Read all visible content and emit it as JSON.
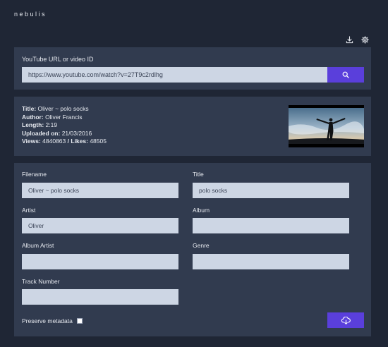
{
  "app": {
    "title": "nebulis"
  },
  "toolbar": {
    "download_icon": "download-icon",
    "settings_icon": "gear-icon"
  },
  "url_section": {
    "label": "YouTube URL or video ID",
    "value": "https://www.youtube.com/watch?v=27T9c2rdlhg",
    "search_icon": "search-icon"
  },
  "video_info": {
    "title_label": "Title:",
    "title": "Oliver ~ polo socks",
    "author_label": "Author:",
    "author": "Oliver Francis",
    "length_label": "Length:",
    "length": "2:19",
    "uploaded_label": "Uploaded on:",
    "uploaded": "21/03/2016",
    "views_label": "Views:",
    "views": "4840863",
    "separator": "/",
    "likes_label": "Likes:",
    "likes": "48505"
  },
  "metadata": {
    "filename": {
      "label": "Filename",
      "value": "Oliver ~ polo socks"
    },
    "title": {
      "label": "Title",
      "value": "polo socks"
    },
    "artist": {
      "label": "Artist",
      "value": "Oliver"
    },
    "album": {
      "label": "Album",
      "value": ""
    },
    "album_artist": {
      "label": "Album Artist",
      "value": ""
    },
    "genre": {
      "label": "Genre",
      "value": ""
    },
    "track_number": {
      "label": "Track Number",
      "value": ""
    },
    "preserve_label": "Preserve metadata",
    "preserve_checked": false,
    "download_icon": "cloud-download-icon"
  },
  "colors": {
    "background": "#1f2635",
    "panel": "#313b4f",
    "input": "#cdd6e4",
    "accent": "#5a3fdb"
  }
}
